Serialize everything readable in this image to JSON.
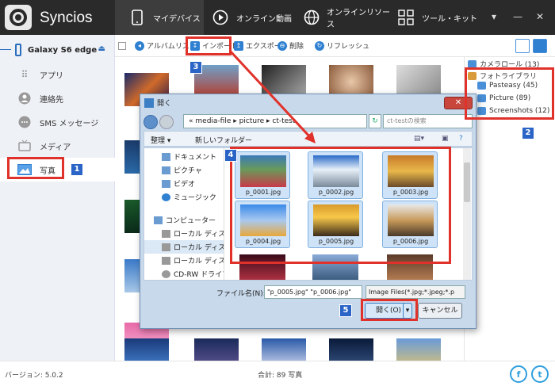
{
  "app": {
    "name": "Syncios",
    "version": "バージョン: 5.0.2"
  },
  "nav": {
    "tabs": [
      {
        "label": "マイデバイス",
        "icon": "phone-icon",
        "active": true
      },
      {
        "label": "オンライン動画",
        "icon": "play-circle-icon",
        "active": false
      },
      {
        "label": "オンラインリソース",
        "icon": "globe-icon",
        "active": false
      },
      {
        "label": "ツール・キット",
        "icon": "grid-icon",
        "active": false
      }
    ],
    "window_controls": [
      "▾",
      "—",
      "✕"
    ]
  },
  "sidebar": {
    "device": "Galaxy S6 edge",
    "eject": "⏏",
    "items": [
      {
        "label": "アプリ",
        "icon": "apps-grid-icon"
      },
      {
        "label": "連絡先",
        "icon": "contact-icon"
      },
      {
        "label": "SMS メッセージ",
        "icon": "message-icon"
      },
      {
        "label": "メディア",
        "icon": "tv-icon"
      },
      {
        "label": "写真",
        "icon": "photo-icon",
        "active": true
      }
    ]
  },
  "toolbar": {
    "album_list": "アルバムリスト",
    "import": "インポート",
    "export": "エクスポート",
    "delete": "削除",
    "refresh": "リフレッシュ"
  },
  "right_panel": {
    "camera_roll": "カメラロール (13)",
    "photo_library": "フォトライブラリ",
    "albums": [
      "Pasteasy (45)",
      "Picture (89)",
      "Screenshots (12)"
    ]
  },
  "footer": {
    "total": "合計: 89 写真",
    "social": [
      "f",
      "t"
    ]
  },
  "dialog": {
    "title": "開く",
    "close": "✕",
    "path": [
      "«",
      "media-file",
      "▸",
      "picture",
      "▸",
      "ct-test"
    ],
    "search_placeholder": "ct-testの検索",
    "organize": "整理 ▾",
    "new_folder": "新しいフォルダー",
    "tree": [
      "ドキュメント",
      "ピクチャ",
      "ビデオ",
      "ミュージック",
      "コンピューター",
      "ローカル ディスク",
      "ローカル ディスク",
      "ローカル ディスク",
      "CD-RW ドライブ"
    ],
    "files": [
      "p_0001.jpg",
      "p_0002.jpg",
      "p_0003.jpg",
      "p_0004.jpg",
      "p_0005.jpg",
      "p_0006.jpg"
    ],
    "filename_label": "ファイル名(N):",
    "filename_value": "\"p_0005.jpg\" \"p_0006.jpg\"",
    "filetype": "Image Files(*.jpg;*.jpeg;*.p",
    "open_btn": "開く(O)",
    "cancel_btn": "キャンセル"
  },
  "badges": [
    "1",
    "2",
    "3",
    "4",
    "5"
  ],
  "colors": {
    "accent": "#2f80d1",
    "highlight": "#e0322a",
    "badge": "#2a64c6"
  }
}
